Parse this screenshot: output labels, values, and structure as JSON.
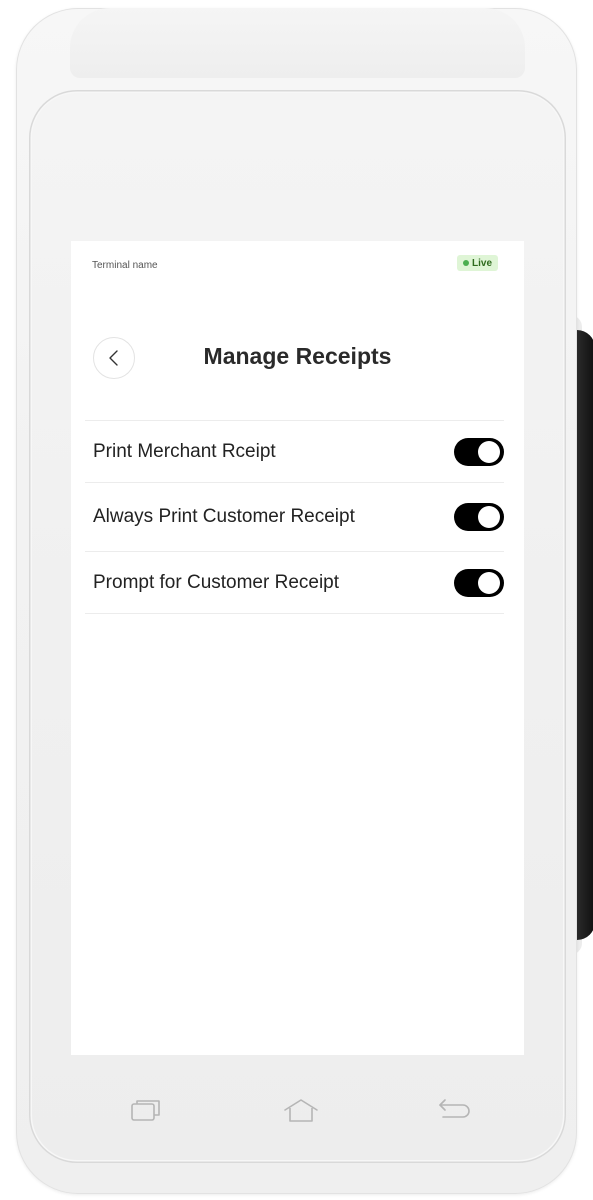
{
  "header": {
    "terminal_name": "Terminal name",
    "status_badge": "Live",
    "status_color": "#4caf50"
  },
  "page": {
    "title": "Manage Receipts",
    "back_icon": "chevron-left-icon"
  },
  "settings": [
    {
      "label": "Print Merchant Rceipt",
      "enabled": true
    },
    {
      "label": "Always Print Customer Receipt",
      "enabled": true
    },
    {
      "label": "Prompt for Customer Receipt",
      "enabled": true
    }
  ],
  "nav_bar": {
    "icons": [
      "recent-apps-icon",
      "home-icon",
      "back-icon"
    ]
  },
  "colors": {
    "toggle_on": "#000000",
    "live_badge_bg": "#dff5d6",
    "live_badge_text": "#2f6b1e"
  }
}
